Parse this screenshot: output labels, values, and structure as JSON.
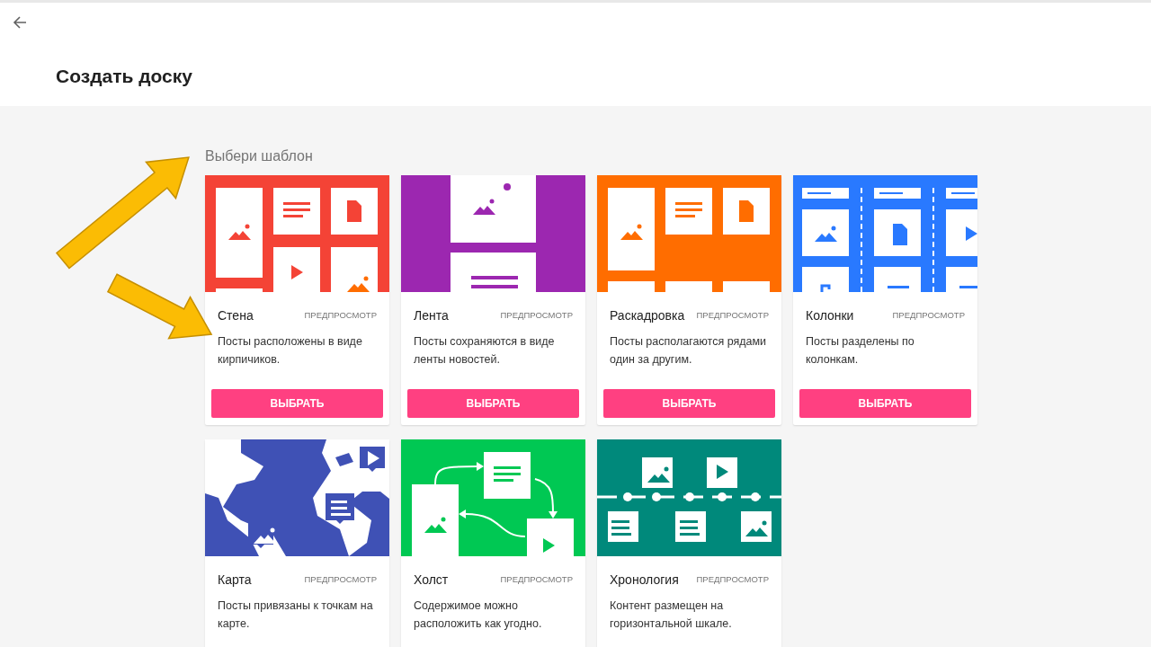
{
  "page_title": "Создать доску",
  "section_label": "Выбери шаблон",
  "templates": [
    {
      "kind": "wall",
      "color": "#f44336",
      "name": "Стена",
      "preview": "ПРЕДПРОСМОТР",
      "description": "Посты расположены в виде кирпичиков.",
      "button": "ВЫБРАТЬ"
    },
    {
      "kind": "stream",
      "color": "#9c27b0",
      "name": "Лента",
      "preview": "ПРЕДПРОСМОТР",
      "description": "Посты сохраняются в виде ленты новостей.",
      "button": "ВЫБРАТЬ"
    },
    {
      "kind": "storyboard",
      "color": "#ff6d00",
      "name": "Раскадровка",
      "preview": "ПРЕДПРОСМОТР",
      "description": "Посты располагаются рядами один за другим.",
      "button": "ВЫБРАТЬ"
    },
    {
      "kind": "columns",
      "color": "#2979ff",
      "name": "Колонки",
      "preview": "ПРЕДПРОСМОТР",
      "description": "Посты разделены по колонкам.",
      "button": "ВЫБРАТЬ"
    },
    {
      "kind": "map",
      "color": "#3f51b5",
      "name": "Карта",
      "preview": "ПРЕДПРОСМОТР",
      "description": "Посты привязаны к точкам на карте."
    },
    {
      "kind": "canvas",
      "color": "#00c853",
      "name": "Холст",
      "preview": "ПРЕДПРОСМОТР",
      "description": "Содержимое можно расположить как угодно."
    },
    {
      "kind": "timeline",
      "color": "#00897b",
      "name": "Хронология",
      "preview": "ПРЕДПРОСМОТР",
      "description": "Контент размещен на горизонтальной шкале."
    }
  ]
}
